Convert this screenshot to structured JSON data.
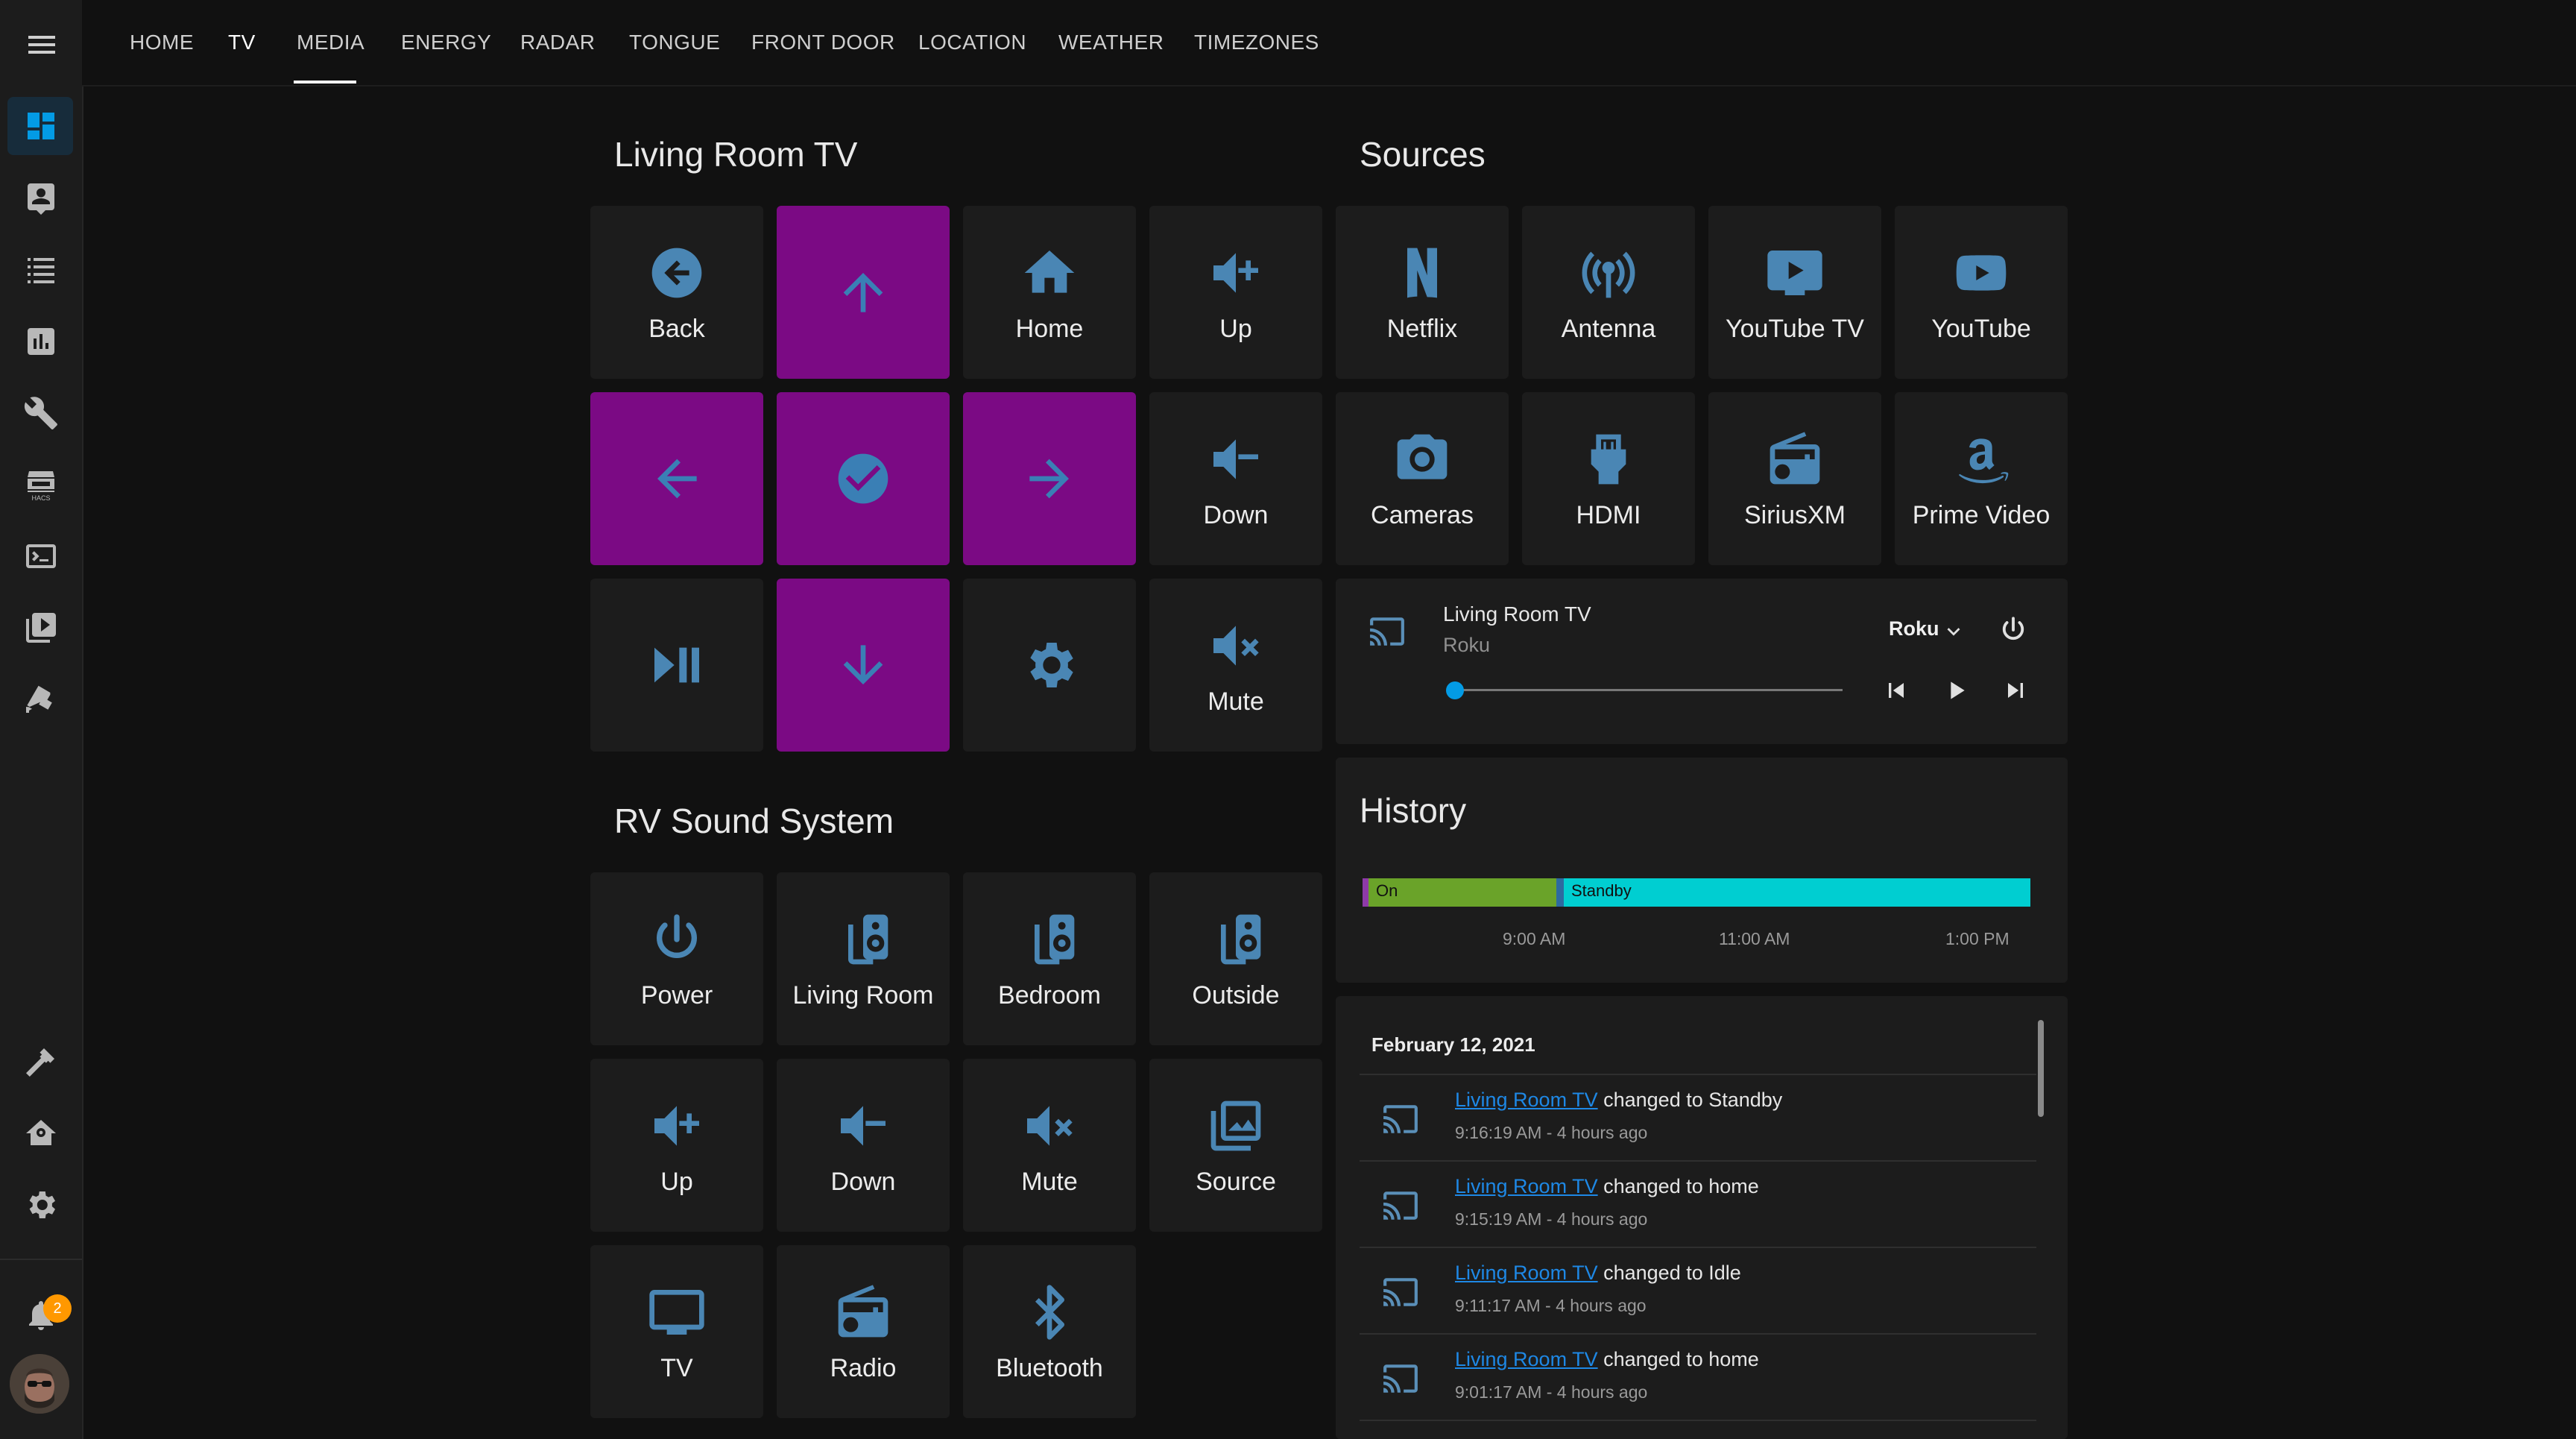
{
  "tabs": [
    {
      "label": "HOME"
    },
    {
      "label": "TV"
    },
    {
      "label": "MEDIA"
    },
    {
      "label": "ENERGY"
    },
    {
      "label": "RADAR"
    },
    {
      "label": "TONGUE"
    },
    {
      "label": "FRONT DOOR"
    },
    {
      "label": "LOCATION"
    },
    {
      "label": "WEATHER"
    },
    {
      "label": "TIMEZONES"
    }
  ],
  "active_tab": "TV",
  "sidebar": {
    "items": [
      "dashboard-icon",
      "map-icon",
      "logbook-icon",
      "history-icon",
      "wrench-icon",
      "hacs-icon",
      "terminal-icon",
      "media-icon",
      "cctv-icon"
    ],
    "bottom_items": [
      "hammer-icon",
      "home-settings-icon",
      "gear-icon"
    ],
    "notification_count": "2"
  },
  "living_room_tv": {
    "title": "Living Room TV",
    "buttons": {
      "back": "Back",
      "home": "Home",
      "vol_up": "Up",
      "vol_down": "Down",
      "mute": "Mute"
    }
  },
  "rv_sound": {
    "title": "RV Sound System",
    "buttons": {
      "power": "Power",
      "living_room": "Living Room",
      "bedroom": "Bedroom",
      "outside": "Outside",
      "up": "Up",
      "down": "Down",
      "mute": "Mute",
      "source": "Source",
      "tv": "TV",
      "radio": "Radio",
      "bluetooth": "Bluetooth"
    }
  },
  "sources": {
    "title": "Sources",
    "items": [
      "Netflix",
      "Antenna",
      "YouTube TV",
      "YouTube",
      "Cameras",
      "HDMI",
      "SiriusXM",
      "Prime Video"
    ]
  },
  "media_player": {
    "title": "Living Room TV",
    "subtitle": "Roku",
    "source": "Roku",
    "progress": 0
  },
  "history": {
    "title": "History",
    "segments": [
      {
        "label": "On",
        "color": "#6aa329"
      },
      {
        "label": "Standby",
        "color": "#00ced1"
      }
    ],
    "ticks": [
      "9:00 AM",
      "11:00 AM",
      "1:00 PM"
    ]
  },
  "logbook": {
    "date": "February 12, 2021",
    "entries": [
      {
        "entity": "Living Room TV",
        "text": "changed to Standby",
        "time": "9:16:19 AM - 4 hours ago"
      },
      {
        "entity": "Living Room TV",
        "text": "changed to home",
        "time": "9:15:19 AM - 4 hours ago"
      },
      {
        "entity": "Living Room TV",
        "text": "changed to Idle",
        "time": "9:11:17 AM - 4 hours ago"
      },
      {
        "entity": "Living Room TV",
        "text": "changed to home",
        "time": "9:01:17 AM - 4 hours ago"
      }
    ]
  },
  "colors": {
    "icon": "#4a86b4",
    "accent_tile": "#7b0a84",
    "accent_icon": "#3a7fb5",
    "link": "#1e88e5"
  }
}
